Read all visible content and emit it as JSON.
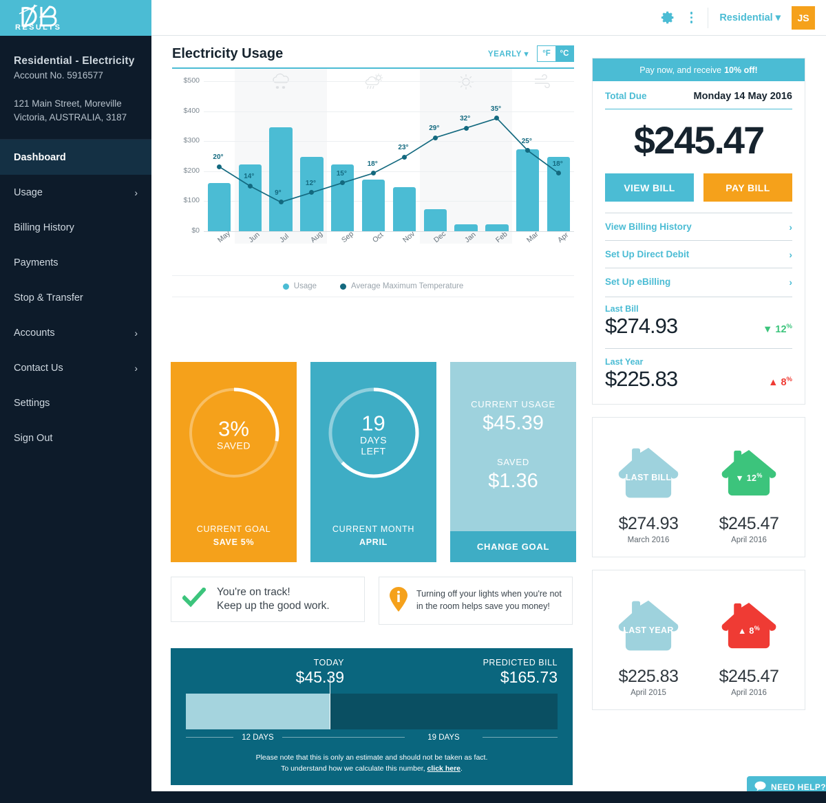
{
  "brand": {
    "logo_text": "ØB",
    "logo_sub": "RESULTS",
    "teal": "#4bbcd4",
    "orange": "#f5a11b",
    "navy": "#0d1b2a"
  },
  "topbar": {
    "gear_icon": "gear-icon",
    "more_icon": "three-dots-icon",
    "account_switcher": "Residential ▾",
    "avatar_initials": "JS"
  },
  "sidebar": {
    "account_name": "Residential - Electricity",
    "account_number": "Account No. 5916577",
    "address_line1": "121 Main Street, Moreville",
    "address_line2": "Victoria, AUSTRALIA, 3187",
    "items": [
      {
        "label": "Dashboard",
        "active": true,
        "chevron": ""
      },
      {
        "label": "Usage",
        "active": false,
        "chevron": "›"
      },
      {
        "label": "Billing History",
        "active": false,
        "chevron": ""
      },
      {
        "label": "Payments",
        "active": false,
        "chevron": ""
      },
      {
        "label": "Stop & Transfer",
        "active": false,
        "chevron": ""
      },
      {
        "label": "Accounts",
        "active": false,
        "chevron": "›"
      },
      {
        "label": "Contact Us",
        "active": false,
        "chevron": "›"
      },
      {
        "label": "Settings",
        "active": false,
        "chevron": ""
      },
      {
        "label": "Sign Out",
        "active": false,
        "chevron": ""
      }
    ]
  },
  "chart_header": {
    "title": "Electricity Usage",
    "period_select": "YEARLY ▾",
    "unit_f": "°F",
    "unit_c": "°C",
    "unit_active": "°C"
  },
  "chart_data": {
    "type": "bar",
    "title": "Electricity Usage",
    "xlabel": "",
    "ylabel": "",
    "ylim": [
      0,
      500
    ],
    "yticks": [
      "$0",
      "$100",
      "$200",
      "$300",
      "$400",
      "$500"
    ],
    "grid": true,
    "legend_position": "bottom",
    "categories": [
      "May",
      "Jun",
      "Jul",
      "Aug",
      "Sep",
      "Oct",
      "Nov",
      "Dec",
      "Jan",
      "Feb",
      "Mar",
      "Apr"
    ],
    "series": [
      {
        "name": "Usage",
        "type": "bar",
        "color": "#4bbcd4",
        "values": [
          160,
          222,
          347,
          247,
          222,
          172,
          147,
          73,
          22,
          22,
          272,
          247
        ]
      },
      {
        "name": "Average Maximum Temperature",
        "type": "line",
        "color": "#13697f",
        "unit": "°C",
        "values": [
          20,
          14,
          9,
          12,
          15,
          18,
          23,
          29,
          32,
          35,
          25,
          18
        ],
        "labels": [
          "20°",
          "14°",
          "9°",
          "12°",
          "15°",
          "18°",
          "23°",
          "29°",
          "32°",
          "35°",
          "25°",
          "18°"
        ]
      }
    ],
    "season_bands": [
      {
        "icon": "snow-icon",
        "months": [
          "Jun",
          "Jul",
          "Aug"
        ]
      },
      {
        "icon": "rain-sun-icon",
        "months": [
          "Sep",
          "Oct",
          "Nov"
        ]
      },
      {
        "icon": "sun-icon",
        "months": [
          "Dec",
          "Jan",
          "Feb"
        ]
      },
      {
        "icon": "wind-icon",
        "months": [
          "Mar",
          "Apr"
        ]
      }
    ]
  },
  "goal_cards": {
    "saved": {
      "percent_text": "3%",
      "saved_label": "SAVED",
      "foot_caption": "CURRENT GOAL",
      "foot_value": "SAVE 5%",
      "progress_percent": 3,
      "bg": "#f5a11b"
    },
    "days": {
      "number": "19",
      "line1": "DAYS",
      "line2": "LEFT",
      "foot_caption": "CURRENT MONTH",
      "foot_value": "APRIL",
      "progress_percent": 63,
      "bg": "#3eadc5"
    },
    "usage": {
      "usage_label": "CURRENT USAGE",
      "usage_amount": "$45.39",
      "saved_label": "SAVED",
      "saved_amount": "$1.36",
      "button": "CHANGE GOAL",
      "bg": "#9ed2dd"
    }
  },
  "tips": {
    "on_track_icon": "check-icon",
    "on_track_line1": "You're on track!",
    "on_track_line2": "Keep up the good work.",
    "info_icon": "info-pin-icon",
    "info_line1": "Turning off your lights when you're not",
    "info_line2": "in the room helps save you money!"
  },
  "predicted": {
    "today_caption": "TODAY",
    "today_value": "$45.39",
    "predicted_caption": "PREDICTED BILL",
    "predicted_value": "$165.73",
    "days_elapsed": "12 DAYS",
    "days_remaining": "19 DAYS",
    "elapsed_fraction": 38.7,
    "note_line1": "Please note that this is only an estimate and should not be taken as fact.",
    "note_line2_pre": "To understand how we calculate this number, ",
    "note_link": "click here",
    "note_line2_post": "."
  },
  "bill_panel": {
    "promo_text": "Pay now, and receive ",
    "promo_bold": "10% off!",
    "total_due_label": "Total Due",
    "due_date": "Monday 14 May 2016",
    "amount": "$245.47",
    "view_bill": "VIEW BILL",
    "pay_bill": "PAY BILL",
    "links": [
      {
        "label": "View Billing History",
        "chevron": "›"
      },
      {
        "label": "Set Up Direct Debit",
        "chevron": "›"
      },
      {
        "label": "Set Up eBilling",
        "chevron": "›"
      }
    ],
    "last_bill": {
      "caption": "Last Bill",
      "amount": "$274.93",
      "delta": "12",
      "delta_arrow": "▼",
      "delta_unit": "%",
      "direction": "down"
    },
    "last_year": {
      "caption": "Last Year",
      "amount": "$225.83",
      "delta": "8",
      "delta_arrow": "▲",
      "delta_unit": "%",
      "direction": "up"
    }
  },
  "compare_cards": [
    {
      "left": {
        "house_label": "LAST BILL",
        "amount": "$274.93",
        "sub": "March 2016",
        "color": "#9ed2dd"
      },
      "right": {
        "house_label": "▼ 12",
        "house_label_unit": "%",
        "amount": "$245.47",
        "sub": "April 2016",
        "color": "#3cc47c"
      }
    },
    {
      "left": {
        "house_label": "LAST YEAR",
        "amount": "$225.83",
        "sub": "April 2015",
        "color": "#9ed2dd"
      },
      "right": {
        "house_label": "▲ 8",
        "house_label_unit": "%",
        "amount": "$245.47",
        "sub": "April 2016",
        "color": "#ef3b34"
      }
    }
  ],
  "need_help": {
    "icon": "chat-bubble-icon",
    "label": "NEED HELP?"
  }
}
